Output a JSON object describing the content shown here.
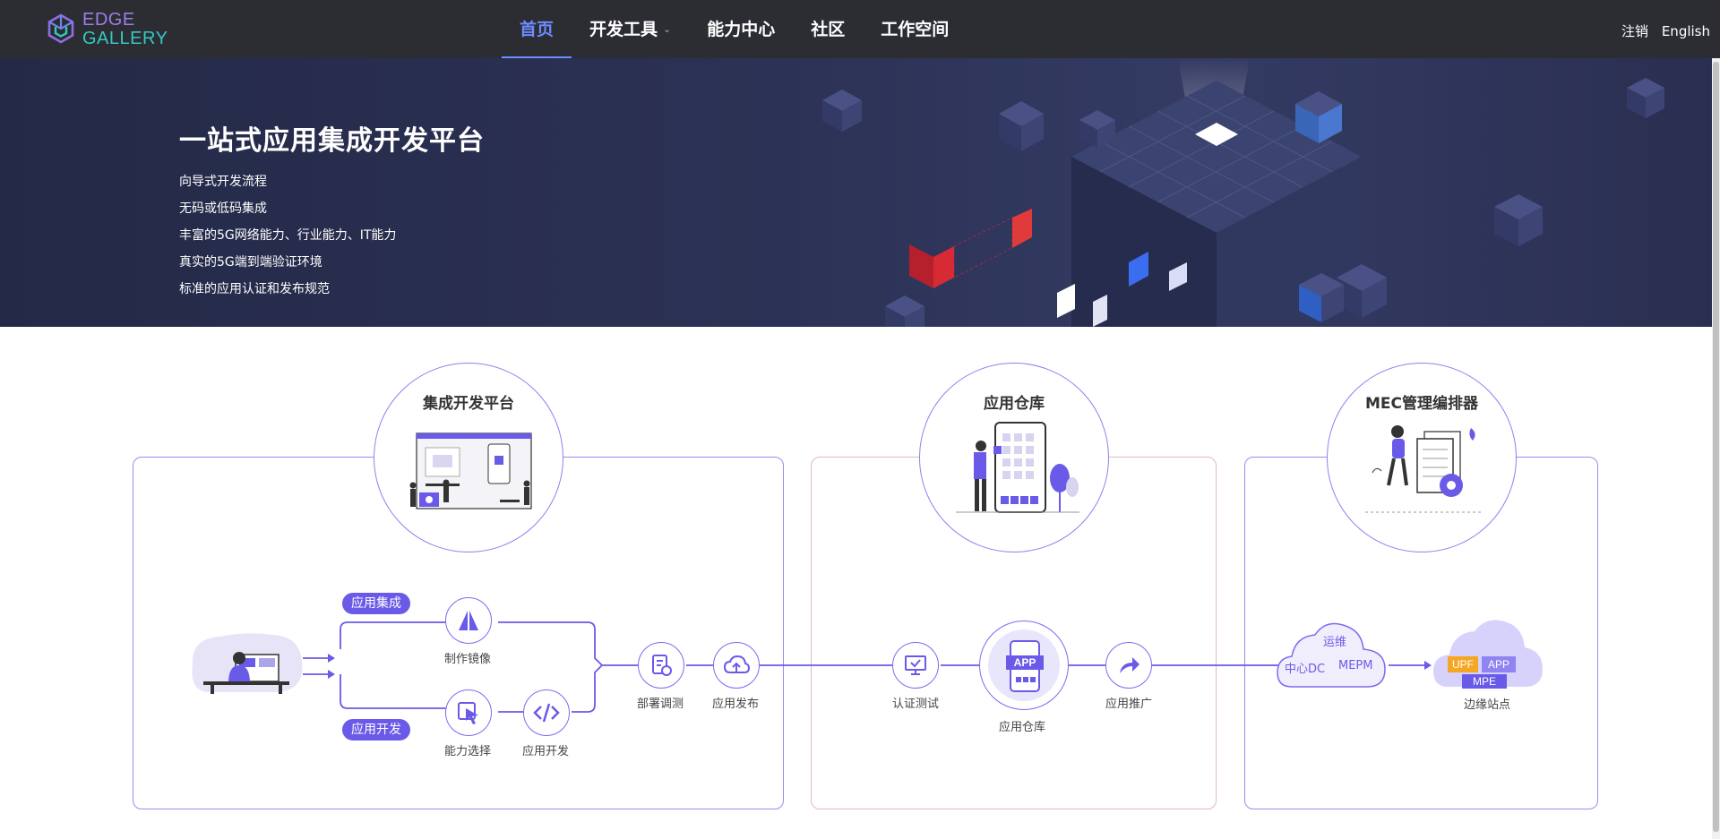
{
  "logo": {
    "line1": "EDGE",
    "line2": "GALLERY"
  },
  "nav": {
    "items": [
      {
        "label": "首页",
        "active": true
      },
      {
        "label": "开发工具",
        "has_dropdown": true
      },
      {
        "label": "能力中心"
      },
      {
        "label": "社区"
      },
      {
        "label": "工作空间"
      }
    ]
  },
  "top_right": {
    "logout": "注销",
    "language": "English"
  },
  "hero": {
    "title": "一站式应用集成开发平台",
    "features": [
      "向导式开发流程",
      "无码或低码集成",
      "丰富的5G网络能力、行业能力、IT能力",
      "真实的5G端到端验证环境",
      "标准的应用认证和发布规范"
    ]
  },
  "flow": {
    "sections": {
      "platform": {
        "title": "集成开发平台"
      },
      "store": {
        "title": "应用仓库"
      },
      "mec": {
        "title": "MEC管理编排器"
      }
    },
    "tags": {
      "integration": "应用集成",
      "development": "应用开发"
    },
    "nodes": {
      "image": "制作镜像",
      "capability": "能力选择",
      "develop": "应用开发",
      "deploy": "部署调测",
      "publish": "应用发布",
      "certify": "认证测试",
      "store": "应用仓库",
      "promote": "应用推广",
      "edge": "边缘站点"
    },
    "store_badge": "APP",
    "center_cloud": {
      "ops": "运维",
      "dc": "中心DC",
      "mepm": "MEPM"
    },
    "edge_cloud": {
      "upf": "UPF",
      "app": "APP",
      "mpe": "MPE"
    }
  },
  "colors": {
    "accent": "#6a5ae8",
    "nav_active": "#6e8bff",
    "topbar": "#2c2d33",
    "panel_border": "#9a8cf0"
  }
}
